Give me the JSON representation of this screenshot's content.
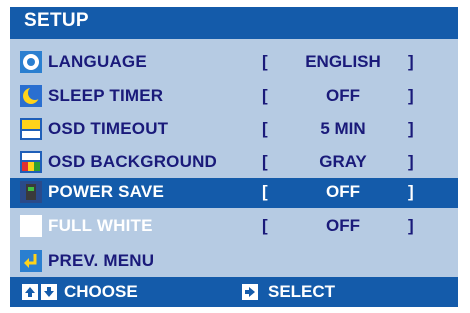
{
  "menu": {
    "title": "SETUP",
    "items": [
      {
        "label": "LANGUAGE",
        "value": "ENGLISH",
        "icon": "language-icon"
      },
      {
        "label": "SLEEP TIMER",
        "value": "OFF",
        "icon": "moon-icon"
      },
      {
        "label": "OSD TIMEOUT",
        "value": "5 MIN",
        "icon": "osd-timeout-icon"
      },
      {
        "label": "OSD BACKGROUND",
        "value": "GRAY",
        "icon": "osd-background-icon"
      },
      {
        "label": "POWER SAVE",
        "value": "OFF",
        "icon": "power-save-icon"
      },
      {
        "label": "FULL WHITE",
        "value": "OFF",
        "icon": "white-square-icon"
      },
      {
        "label": "PREV. MENU",
        "icon": "return-arrow-icon"
      }
    ],
    "bracket_open": "[",
    "bracket_close": "]"
  },
  "footer": {
    "choose_label": "CHOOSE",
    "select_label": "SELECT",
    "choose_icons": [
      "arrow-up-icon",
      "arrow-down-icon"
    ],
    "select_icon": "arrow-right-icon"
  },
  "colors": {
    "panel_bg": "#b6cbe3",
    "bar_bg": "#145baa",
    "text": "#1a1a7a",
    "highlight_text": "#ffffff"
  }
}
